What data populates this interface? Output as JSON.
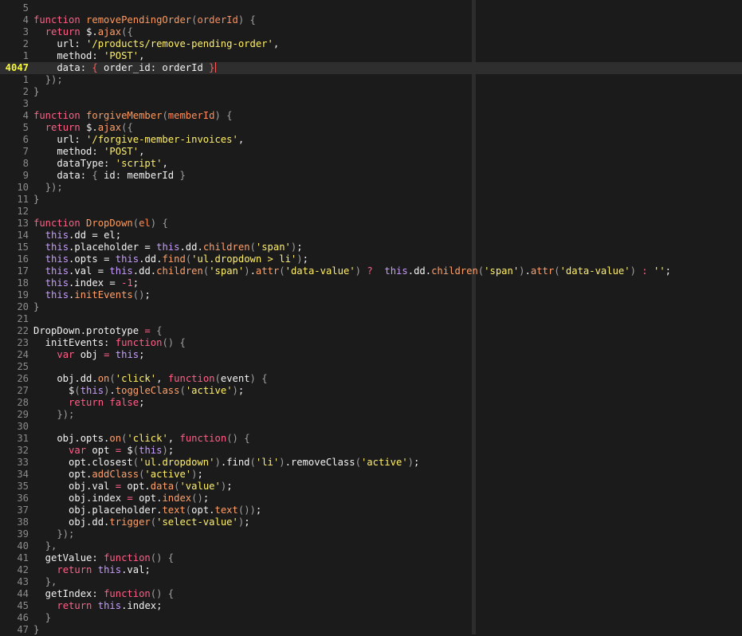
{
  "editor": {
    "current_line": "4047",
    "lines": [
      {
        "n": "5",
        "t": []
      },
      {
        "n": "4",
        "t": [
          [
            "kw",
            "function "
          ],
          [
            "fn",
            "removePendingOrder"
          ],
          [
            "punc",
            "("
          ],
          [
            "param",
            "orderId"
          ],
          [
            "punc",
            ") {"
          ]
        ]
      },
      {
        "n": "3",
        "t": [
          [
            "plain",
            "  "
          ],
          [
            "kw",
            "return "
          ],
          [
            "plain",
            "$."
          ],
          [
            "call",
            "ajax"
          ],
          [
            "punc",
            "({"
          ]
        ]
      },
      {
        "n": "2",
        "t": [
          [
            "plain",
            "    url: "
          ],
          [
            "str",
            "'/products/remove-pending-order'"
          ],
          [
            "plain",
            ","
          ]
        ]
      },
      {
        "n": "1",
        "t": [
          [
            "plain",
            "    method: "
          ],
          [
            "str",
            "'POST'"
          ],
          [
            "plain",
            ","
          ]
        ]
      },
      {
        "n": "4047",
        "current": true,
        "t": [
          [
            "plain",
            "    data: "
          ],
          [
            "bracket-hl",
            "{"
          ],
          [
            "plain",
            " order_id: orderId "
          ],
          [
            "bracket-hl",
            "}"
          ],
          [
            "cursor",
            ""
          ]
        ]
      },
      {
        "n": "1",
        "t": [
          [
            "plain",
            "  "
          ],
          [
            "punc",
            "});"
          ]
        ]
      },
      {
        "n": "2",
        "t": [
          [
            "punc",
            "}"
          ]
        ]
      },
      {
        "n": "3",
        "t": []
      },
      {
        "n": "4",
        "t": [
          [
            "kw",
            "function "
          ],
          [
            "fn",
            "forgiveMember"
          ],
          [
            "punc",
            "("
          ],
          [
            "param",
            "memberId"
          ],
          [
            "punc",
            ") {"
          ]
        ]
      },
      {
        "n": "5",
        "t": [
          [
            "plain",
            "  "
          ],
          [
            "kw",
            "return "
          ],
          [
            "plain",
            "$."
          ],
          [
            "call",
            "ajax"
          ],
          [
            "punc",
            "({"
          ]
        ]
      },
      {
        "n": "6",
        "t": [
          [
            "plain",
            "    url: "
          ],
          [
            "str",
            "'/forgive-member-invoices'"
          ],
          [
            "plain",
            ","
          ]
        ]
      },
      {
        "n": "7",
        "t": [
          [
            "plain",
            "    method: "
          ],
          [
            "str",
            "'POST'"
          ],
          [
            "plain",
            ","
          ]
        ]
      },
      {
        "n": "8",
        "t": [
          [
            "plain",
            "    dataType: "
          ],
          [
            "str",
            "'script'"
          ],
          [
            "plain",
            ","
          ]
        ]
      },
      {
        "n": "9",
        "t": [
          [
            "plain",
            "    data: "
          ],
          [
            "punc",
            "{"
          ],
          [
            "plain",
            " id: memberId "
          ],
          [
            "punc",
            "}"
          ]
        ]
      },
      {
        "n": "10",
        "t": [
          [
            "plain",
            "  "
          ],
          [
            "punc",
            "});"
          ]
        ]
      },
      {
        "n": "11",
        "t": [
          [
            "punc",
            "}"
          ]
        ]
      },
      {
        "n": "12",
        "t": []
      },
      {
        "n": "13",
        "t": [
          [
            "kw",
            "function "
          ],
          [
            "fn",
            "DropDown"
          ],
          [
            "punc",
            "("
          ],
          [
            "param",
            "el"
          ],
          [
            "punc",
            ") {"
          ]
        ]
      },
      {
        "n": "14",
        "t": [
          [
            "plain",
            "  "
          ],
          [
            "this",
            "this"
          ],
          [
            "plain",
            ".dd = el;"
          ]
        ]
      },
      {
        "n": "15",
        "t": [
          [
            "plain",
            "  "
          ],
          [
            "this",
            "this"
          ],
          [
            "plain",
            ".placeholder = "
          ],
          [
            "this",
            "this"
          ],
          [
            "plain",
            ".dd."
          ],
          [
            "call",
            "children"
          ],
          [
            "punc",
            "("
          ],
          [
            "str",
            "'span'"
          ],
          [
            "punc",
            ")"
          ],
          [
            "plain",
            ";"
          ]
        ]
      },
      {
        "n": "16",
        "t": [
          [
            "plain",
            "  "
          ],
          [
            "this",
            "this"
          ],
          [
            "plain",
            ".opts = "
          ],
          [
            "this",
            "this"
          ],
          [
            "plain",
            ".dd."
          ],
          [
            "call",
            "find"
          ],
          [
            "punc",
            "("
          ],
          [
            "str",
            "'ul.dropdown > li'"
          ],
          [
            "punc",
            ")"
          ],
          [
            "plain",
            ";"
          ]
        ]
      },
      {
        "n": "17",
        "t": [
          [
            "plain",
            "  "
          ],
          [
            "this",
            "this"
          ],
          [
            "plain",
            ".val = "
          ],
          [
            "this",
            "this"
          ],
          [
            "plain",
            ".dd."
          ],
          [
            "call",
            "children"
          ],
          [
            "punc",
            "("
          ],
          [
            "str",
            "'span'"
          ],
          [
            "punc",
            ")"
          ],
          [
            "plain",
            "."
          ],
          [
            "call",
            "attr"
          ],
          [
            "punc",
            "("
          ],
          [
            "str",
            "'data-value'"
          ],
          [
            "punc",
            ")"
          ],
          [
            "kw",
            " ? "
          ],
          [
            "plain",
            " "
          ],
          [
            "this",
            "this"
          ],
          [
            "plain",
            ".dd."
          ],
          [
            "call",
            "children"
          ],
          [
            "punc",
            "("
          ],
          [
            "str",
            "'span'"
          ],
          [
            "punc",
            ")"
          ],
          [
            "plain",
            "."
          ],
          [
            "call",
            "attr"
          ],
          [
            "punc",
            "("
          ],
          [
            "str",
            "'data-value'"
          ],
          [
            "punc",
            ")"
          ],
          [
            "kw",
            " : "
          ],
          [
            "str",
            "''"
          ],
          [
            "plain",
            ";"
          ]
        ]
      },
      {
        "n": "18",
        "t": [
          [
            "plain",
            "  "
          ],
          [
            "this",
            "this"
          ],
          [
            "plain",
            ".index = "
          ],
          [
            "num",
            "-1"
          ],
          [
            "plain",
            ";"
          ]
        ]
      },
      {
        "n": "19",
        "t": [
          [
            "plain",
            "  "
          ],
          [
            "this",
            "this"
          ],
          [
            "plain",
            "."
          ],
          [
            "call",
            "initEvents"
          ],
          [
            "punc",
            "()"
          ],
          [
            "plain",
            ";"
          ]
        ]
      },
      {
        "n": "20",
        "t": [
          [
            "punc",
            "}"
          ]
        ]
      },
      {
        "n": "21",
        "t": []
      },
      {
        "n": "22",
        "t": [
          [
            "plain",
            "DropDown.prototype "
          ],
          [
            "kw",
            "="
          ],
          [
            "punc",
            " {"
          ]
        ]
      },
      {
        "n": "23",
        "t": [
          [
            "plain",
            "  initEvents: "
          ],
          [
            "kw",
            "function"
          ],
          [
            "punc",
            "() {"
          ]
        ]
      },
      {
        "n": "24",
        "t": [
          [
            "plain",
            "    "
          ],
          [
            "kw",
            "var "
          ],
          [
            "plain",
            "obj "
          ],
          [
            "kw",
            "="
          ],
          [
            "plain",
            " "
          ],
          [
            "this",
            "this"
          ],
          [
            "plain",
            ";"
          ]
        ]
      },
      {
        "n": "25",
        "t": []
      },
      {
        "n": "26",
        "t": [
          [
            "plain",
            "    obj.dd."
          ],
          [
            "call",
            "on"
          ],
          [
            "punc",
            "("
          ],
          [
            "str",
            "'click'"
          ],
          [
            "plain",
            ", "
          ],
          [
            "kw",
            "function"
          ],
          [
            "punc",
            "("
          ],
          [
            "plain",
            "event"
          ],
          [
            "punc",
            ") {"
          ]
        ]
      },
      {
        "n": "27",
        "t": [
          [
            "plain",
            "      "
          ],
          [
            "plain",
            "$"
          ],
          [
            "punc",
            "("
          ],
          [
            "this",
            "this"
          ],
          [
            "punc",
            ")"
          ],
          [
            "plain",
            "."
          ],
          [
            "call",
            "toggleClass"
          ],
          [
            "punc",
            "("
          ],
          [
            "str",
            "'active'"
          ],
          [
            "punc",
            ")"
          ],
          [
            "plain",
            ";"
          ]
        ]
      },
      {
        "n": "28",
        "t": [
          [
            "plain",
            "      "
          ],
          [
            "kw",
            "return false"
          ],
          [
            "plain",
            ";"
          ]
        ]
      },
      {
        "n": "29",
        "t": [
          [
            "plain",
            "    "
          ],
          [
            "punc",
            "});"
          ]
        ]
      },
      {
        "n": "30",
        "t": []
      },
      {
        "n": "31",
        "t": [
          [
            "plain",
            "    obj.opts."
          ],
          [
            "call",
            "on"
          ],
          [
            "punc",
            "("
          ],
          [
            "str",
            "'click'"
          ],
          [
            "plain",
            ", "
          ],
          [
            "kw",
            "function"
          ],
          [
            "punc",
            "() {"
          ]
        ]
      },
      {
        "n": "32",
        "t": [
          [
            "plain",
            "      "
          ],
          [
            "kw",
            "var "
          ],
          [
            "plain",
            "opt "
          ],
          [
            "kw",
            "="
          ],
          [
            "plain",
            " $"
          ],
          [
            "punc",
            "("
          ],
          [
            "this",
            "this"
          ],
          [
            "punc",
            ")"
          ],
          [
            "plain",
            ";"
          ]
        ]
      },
      {
        "n": "33",
        "t": [
          [
            "plain",
            "      opt.closest"
          ],
          [
            "punc",
            "("
          ],
          [
            "str",
            "'ul.dropdown'"
          ],
          [
            "punc",
            ")"
          ],
          [
            "plain",
            ".find"
          ],
          [
            "punc",
            "("
          ],
          [
            "str",
            "'li'"
          ],
          [
            "punc",
            ")"
          ],
          [
            "plain",
            ".removeClass"
          ],
          [
            "punc",
            "("
          ],
          [
            "str",
            "'active'"
          ],
          [
            "punc",
            ")"
          ],
          [
            "plain",
            ";"
          ]
        ]
      },
      {
        "n": "34",
        "t": [
          [
            "plain",
            "      opt."
          ],
          [
            "call",
            "addClass"
          ],
          [
            "punc",
            "("
          ],
          [
            "str",
            "'active'"
          ],
          [
            "punc",
            ")"
          ],
          [
            "plain",
            ";"
          ]
        ]
      },
      {
        "n": "35",
        "t": [
          [
            "plain",
            "      obj.val "
          ],
          [
            "kw",
            "="
          ],
          [
            "plain",
            " opt."
          ],
          [
            "call",
            "data"
          ],
          [
            "punc",
            "("
          ],
          [
            "str",
            "'value'"
          ],
          [
            "punc",
            ")"
          ],
          [
            "plain",
            ";"
          ]
        ]
      },
      {
        "n": "36",
        "t": [
          [
            "plain",
            "      obj.index "
          ],
          [
            "kw",
            "="
          ],
          [
            "plain",
            " opt."
          ],
          [
            "call",
            "index"
          ],
          [
            "punc",
            "()"
          ],
          [
            "plain",
            ";"
          ]
        ]
      },
      {
        "n": "37",
        "t": [
          [
            "plain",
            "      obj.placeholder."
          ],
          [
            "call",
            "text"
          ],
          [
            "punc",
            "("
          ],
          [
            "plain",
            "opt."
          ],
          [
            "call",
            "text"
          ],
          [
            "punc",
            "())"
          ],
          [
            "plain",
            ";"
          ]
        ]
      },
      {
        "n": "38",
        "t": [
          [
            "plain",
            "      obj.dd."
          ],
          [
            "call",
            "trigger"
          ],
          [
            "punc",
            "("
          ],
          [
            "str",
            "'select-value'"
          ],
          [
            "punc",
            ")"
          ],
          [
            "plain",
            ";"
          ]
        ]
      },
      {
        "n": "39",
        "t": [
          [
            "plain",
            "    "
          ],
          [
            "punc",
            "});"
          ]
        ]
      },
      {
        "n": "40",
        "t": [
          [
            "plain",
            "  "
          ],
          [
            "punc",
            "},"
          ]
        ]
      },
      {
        "n": "41",
        "t": [
          [
            "plain",
            "  getValue: "
          ],
          [
            "kw",
            "function"
          ],
          [
            "punc",
            "() {"
          ]
        ]
      },
      {
        "n": "42",
        "t": [
          [
            "plain",
            "    "
          ],
          [
            "kw",
            "return "
          ],
          [
            "this",
            "this"
          ],
          [
            "plain",
            ".val;"
          ]
        ]
      },
      {
        "n": "43",
        "t": [
          [
            "plain",
            "  "
          ],
          [
            "punc",
            "},"
          ]
        ]
      },
      {
        "n": "44",
        "t": [
          [
            "plain",
            "  getIndex: "
          ],
          [
            "kw",
            "function"
          ],
          [
            "punc",
            "() {"
          ]
        ]
      },
      {
        "n": "45",
        "t": [
          [
            "plain",
            "    "
          ],
          [
            "kw",
            "return "
          ],
          [
            "this",
            "this"
          ],
          [
            "plain",
            ".index;"
          ]
        ]
      },
      {
        "n": "46",
        "t": [
          [
            "plain",
            "  "
          ],
          [
            "punc",
            "}"
          ]
        ]
      },
      {
        "n": "47",
        "t": [
          [
            "punc",
            "}"
          ]
        ]
      }
    ]
  },
  "colors": {
    "background": "#1b1b1b",
    "current_line_bg": "#2e2e2e",
    "keyword": "#ff5f87",
    "function_name": "#ff9a5c",
    "string": "#ffef6a",
    "this": "#c79cff",
    "line_number": "#8a8a8a",
    "current_line_number": "#f8f83a"
  }
}
